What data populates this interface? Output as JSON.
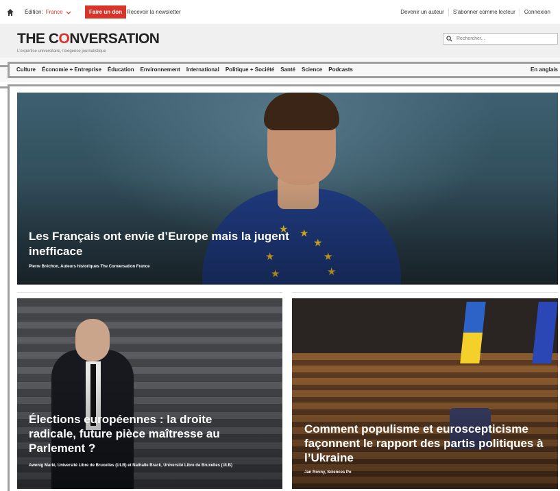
{
  "topbar": {
    "edition_label": "Édition:",
    "edition_value": "France",
    "donate_label": "Faire un don",
    "newsletter_label": "Recevoir la newsletter",
    "right_links": [
      "Devenir un auteur",
      "S'abonner comme lecteur",
      "Connexion"
    ]
  },
  "header": {
    "logo_part1": "THE C",
    "logo_o": "O",
    "logo_part2": "NVERSATION",
    "tagline": "L'expertise universitaire, l'exigence journalistique",
    "search_placeholder": "Rechercher..."
  },
  "nav": {
    "items": [
      "Culture",
      "Économie + Entreprise",
      "Éducation",
      "Environnement",
      "International",
      "Politique + Société",
      "Santé",
      "Science",
      "Podcasts"
    ],
    "english": "En anglais"
  },
  "hero": {
    "title": "Les Français ont envie d’Europe mais la jugent inefficace",
    "byline": "Pierre Bréchon, Auteurs historiques The Conversation France"
  },
  "cards": [
    {
      "title": "Élections européennes : la droite radicale, future pièce maîtresse au Parlement ?",
      "byline": "Awenig Marié, Université Libre de Bruxelles (ULB) et Nathalie Brack, Université Libre de Bruxelles (ULB)"
    },
    {
      "title": "Comment populisme et euroscepticisme façonnent le rapport des partis politiques à l’Ukraine",
      "byline": "Jan Rovny, Sciences Po"
    }
  ],
  "colors": {
    "accent": "#d8352a",
    "annotation_frame": "#9e9e9e"
  },
  "icons": {
    "home": "home-icon",
    "chevron": "chevron-down-icon",
    "search": "search-icon"
  }
}
